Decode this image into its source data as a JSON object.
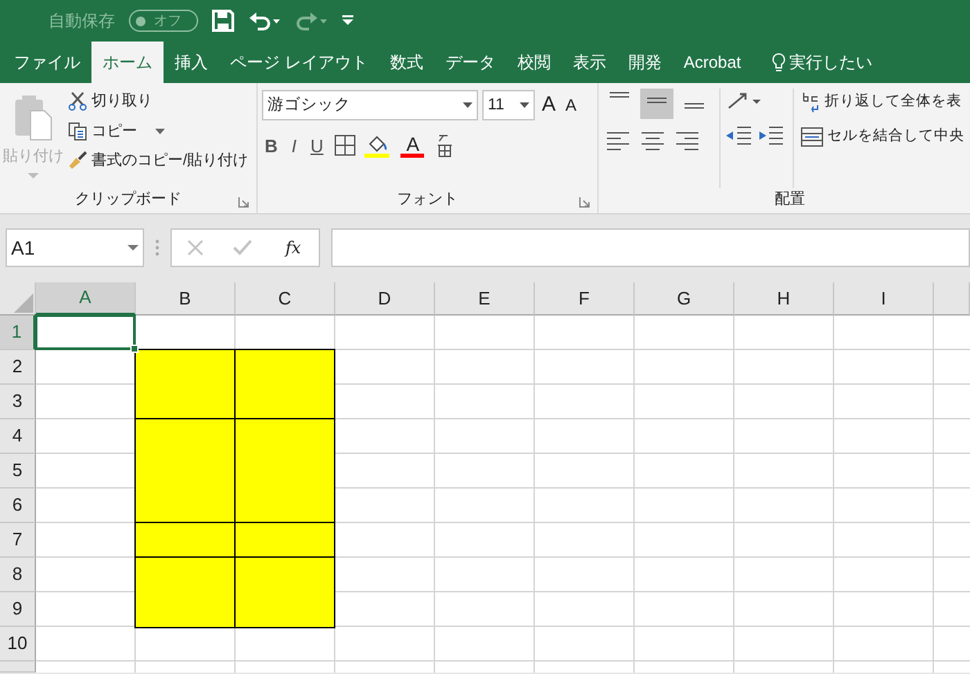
{
  "title_bar": {
    "autosave_label": "自動保存",
    "autosave_toggle": {
      "label": "オフ",
      "on": false
    },
    "redo_disabled": true
  },
  "tabs": [
    {
      "label": "ファイル",
      "selected": false
    },
    {
      "label": "ホーム",
      "selected": true
    },
    {
      "label": "挿入",
      "selected": false
    },
    {
      "label": "ページ レイアウト",
      "selected": false
    },
    {
      "label": "数式",
      "selected": false
    },
    {
      "label": "データ",
      "selected": false
    },
    {
      "label": "校閲",
      "selected": false
    },
    {
      "label": "表示",
      "selected": false
    },
    {
      "label": "開発",
      "selected": false
    },
    {
      "label": "Acrobat",
      "selected": false
    }
  ],
  "tell_me": "実行したい",
  "clipboard": {
    "paste": {
      "label": "貼り付け",
      "disabled": true
    },
    "commands": [
      "切り取り",
      "コピー",
      "書式のコピー/貼り付け"
    ],
    "group_label": "クリップボード"
  },
  "font": {
    "font_name": "游ゴシック",
    "font_size": "11",
    "grow": "A",
    "shrink": "A",
    "styles": [
      "B",
      "I",
      "U"
    ],
    "font_color": "A",
    "group_label": "フォント"
  },
  "alignment": {
    "vertical": [
      {
        "selected": false
      },
      {
        "selected": true
      },
      {
        "selected": false
      }
    ],
    "wrap_text": "折り返して全体を表",
    "merge_center": "セルを結合して中央",
    "group_label": "配置"
  },
  "formula_bar": {
    "name_box": "A1",
    "cancel_disabled": true,
    "enter_disabled": true,
    "function_label": "fx"
  },
  "sheet": {
    "columns": [
      {
        "label": "A",
        "selected": true,
        "filled": false
      },
      {
        "label": "B",
        "selected": false,
        "filled": true
      },
      {
        "label": "C",
        "selected": false,
        "filled": true
      },
      {
        "label": "D",
        "selected": false,
        "filled": false
      },
      {
        "label": "E",
        "selected": false,
        "filled": false
      },
      {
        "label": "F",
        "selected": false,
        "filled": false
      },
      {
        "label": "G",
        "selected": false,
        "filled": false
      },
      {
        "label": "H",
        "selected": false,
        "filled": false
      },
      {
        "label": "I",
        "selected": false,
        "filled": false
      }
    ],
    "rows": [
      {
        "label": "1",
        "selected": true,
        "filled": false
      },
      {
        "label": "2",
        "selected": false,
        "filled": true,
        "block_start": true
      },
      {
        "label": "3",
        "selected": false,
        "filled": true,
        "block_start": false
      },
      {
        "label": "4",
        "selected": false,
        "filled": true,
        "block_start": true
      },
      {
        "label": "5",
        "selected": false,
        "filled": true,
        "block_start": false
      },
      {
        "label": "6",
        "selected": false,
        "filled": true,
        "block_start": false
      },
      {
        "label": "7",
        "selected": false,
        "filled": true,
        "block_start": true
      },
      {
        "label": "8",
        "selected": false,
        "filled": true,
        "block_start": true
      },
      {
        "label": "9",
        "selected": false,
        "filled": true,
        "block_start": false
      },
      {
        "label": "10",
        "selected": false,
        "filled": false
      }
    ]
  }
}
